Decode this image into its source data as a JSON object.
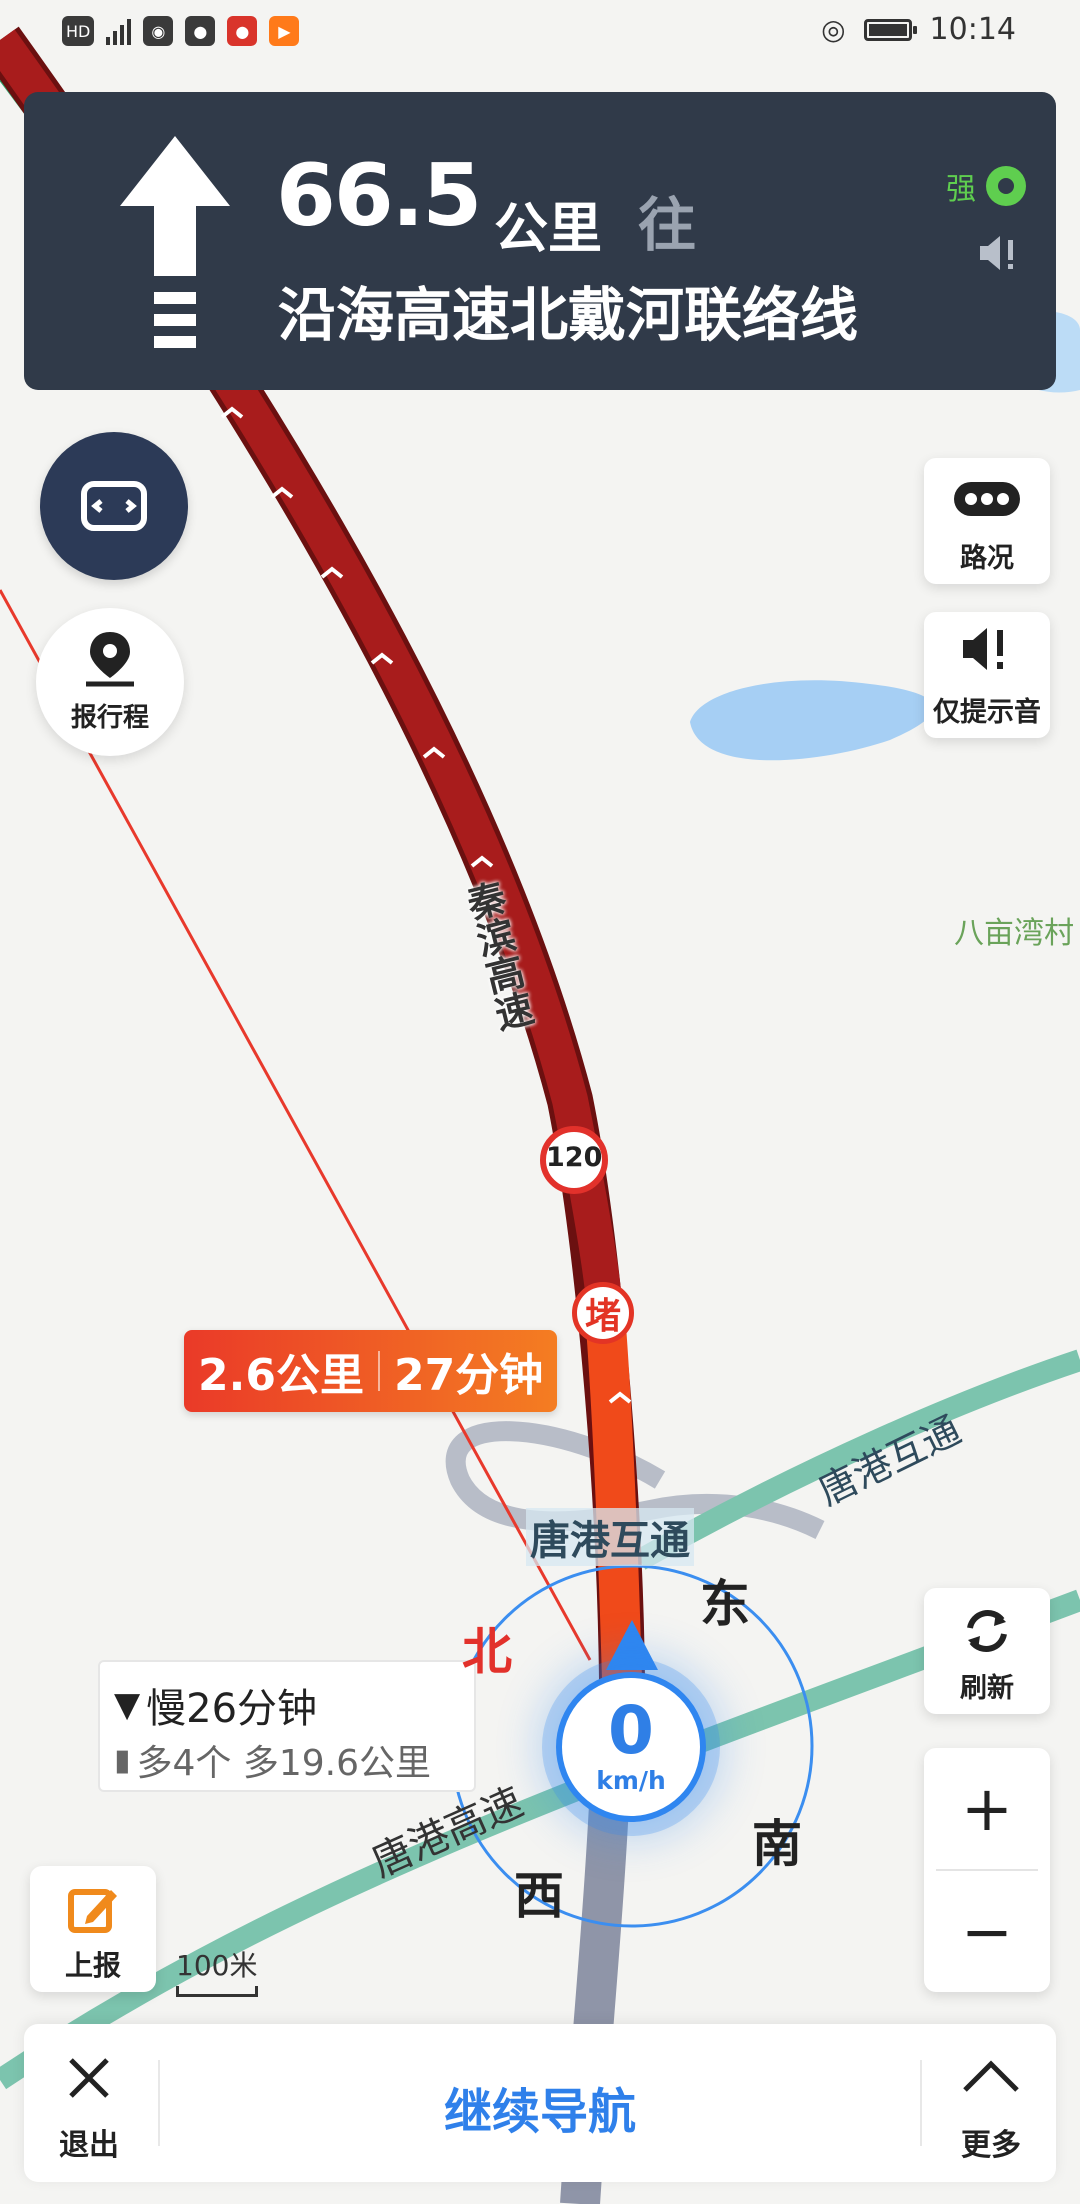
{
  "status_bar": {
    "left_icons": [
      "hd-icon",
      "4g-signal-icon",
      "app-icon-1",
      "wechat-icon",
      "mic-icon",
      "video-icon"
    ],
    "hd_label": "HD",
    "time": "10:14"
  },
  "guidance": {
    "distance_value": "66.5",
    "distance_unit": "公里",
    "towards": "往",
    "road_name": "沿海高速北戴河联络线",
    "gps_strength": "强",
    "colors": {
      "card": "#303a49",
      "gps": "#5fce4f"
    }
  },
  "map": {
    "road_label_main": "秦滨高速",
    "speed_limit": "120",
    "interchange_label": "唐港互通",
    "interchange_label_2": "唐港互通",
    "highway_label": "唐港高速",
    "village_label": "八亩湾村",
    "route_label_bottom": "秦",
    "jam_tag": "堵",
    "jam_distance": "2.6公里",
    "jam_time": "27分钟",
    "colors": {
      "jam_red": "#a81c1c",
      "jam_orange": "#f04a1a",
      "highway": "#7cc4ae",
      "water": "#a6cff4"
    }
  },
  "compass": {
    "north": "北",
    "east": "东",
    "south": "南",
    "west": "西"
  },
  "speed": {
    "value": "0",
    "unit": "km/h"
  },
  "route_compare": {
    "slower": "慢26分钟",
    "extra": "多4个 多19.6公里"
  },
  "buttons": {
    "report_trip": "报行程",
    "traffic": "路况",
    "sound_mode": "仅提示音",
    "refresh": "刷新",
    "zoom_in": "+",
    "zoom_out": "−",
    "report": "上报",
    "exit": "退出",
    "continue": "继续导航",
    "more": "更多"
  },
  "scale": "100米"
}
